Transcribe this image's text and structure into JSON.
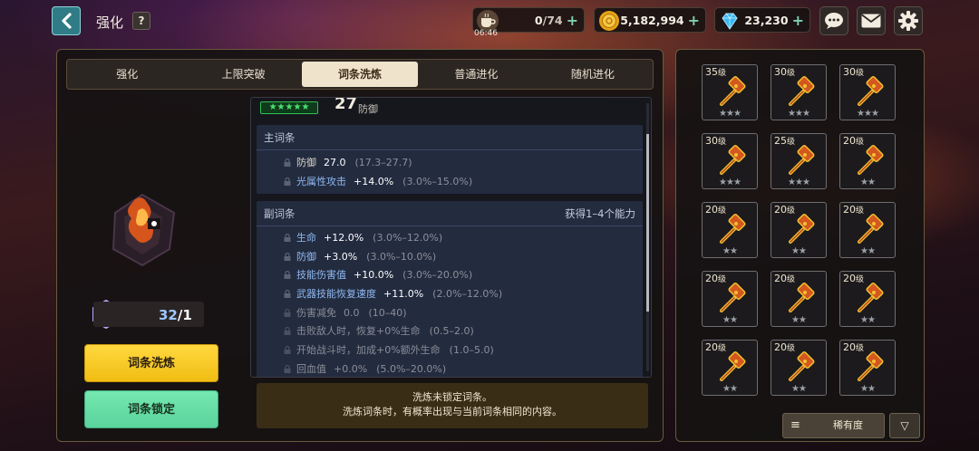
{
  "header": {
    "title": "强化",
    "help": "?",
    "stamina": {
      "value": "0",
      "max": "/74",
      "timer": "06:46"
    },
    "gold": "5,182,994",
    "gems": "23,230",
    "plus": "+"
  },
  "tabs": [
    {
      "label": "强化"
    },
    {
      "label": "上限突破"
    },
    {
      "label": "词条洗炼"
    },
    {
      "label": "普通进化"
    },
    {
      "label": "随机进化"
    }
  ],
  "active_tab": "词条洗炼",
  "item": {
    "stars": "★★★★★",
    "stat_value": "27",
    "stat_type": "防御",
    "level": "32",
    "level_suffix": "/1"
  },
  "main_stats": {
    "title": "主词条",
    "lines": [
      {
        "name": "防御",
        "value": "27.0",
        "range": "(17.3–27.7)"
      },
      {
        "name": "光属性攻击",
        "value": "+14.0%",
        "range": "(3.0%–15.0%)"
      }
    ]
  },
  "sub_stats": {
    "title": "副词条",
    "hint": "获得1–4个能力",
    "lines": [
      {
        "name": "生命",
        "value": "+12.0%",
        "range": "(3.0%–12.0%)"
      },
      {
        "name": "防御",
        "value": "+3.0%",
        "range": "(3.0%–10.0%)"
      },
      {
        "name": "技能伤害值",
        "value": "+10.0%",
        "range": "(3.0%–20.0%)"
      },
      {
        "name": "武器技能恢复速度",
        "value": "+11.0%",
        "range": "(2.0%–12.0%)"
      },
      {
        "name": "伤害减免",
        "value": "0.0",
        "range": "(10–40)"
      },
      {
        "name": "击败敌人时，恢复+0%生命",
        "value": "",
        "range": "(0.5–2.0)"
      },
      {
        "name": "开始战斗时，加成+0%额外生命",
        "value": "",
        "range": "(1.0–5.0)"
      },
      {
        "name": "回血值",
        "value": "+0.0%",
        "range": "(5.0%–20.0%)"
      }
    ]
  },
  "buttons": {
    "reroll": "词条洗炼",
    "lock": "词条锁定"
  },
  "notice": {
    "line1": "洗炼未锁定词条。",
    "line2": "洗炼词条时，有概率出现与当前词条相同的内容。"
  },
  "inventory": {
    "level_suffix": "级",
    "slots": [
      {
        "level": "35",
        "stars": "★★★"
      },
      {
        "level": "30",
        "stars": "★★★"
      },
      {
        "level": "30",
        "stars": "★★★"
      },
      {
        "level": "30",
        "stars": "★★★"
      },
      {
        "level": "25",
        "stars": "★★★"
      },
      {
        "level": "20",
        "stars": "★★"
      },
      {
        "level": "20",
        "stars": "★★"
      },
      {
        "level": "20",
        "stars": "★★"
      },
      {
        "level": "20",
        "stars": "★★"
      },
      {
        "level": "20",
        "stars": "★★"
      },
      {
        "level": "20",
        "stars": "★★"
      },
      {
        "level": "20",
        "stars": "★★"
      },
      {
        "level": "20",
        "stars": "★★"
      },
      {
        "level": "20",
        "stars": "★★"
      },
      {
        "level": "20",
        "stars": "★★"
      }
    ],
    "sort_label": "稀有度",
    "sort_menu_icon": "≡",
    "sort_direction_icon": "▽"
  },
  "colors": {
    "accent_yellow": "#f1bd12",
    "accent_green": "#5bd39c",
    "stat_name_blue": "#8fb9f0",
    "back_button": "#2f7c86"
  }
}
